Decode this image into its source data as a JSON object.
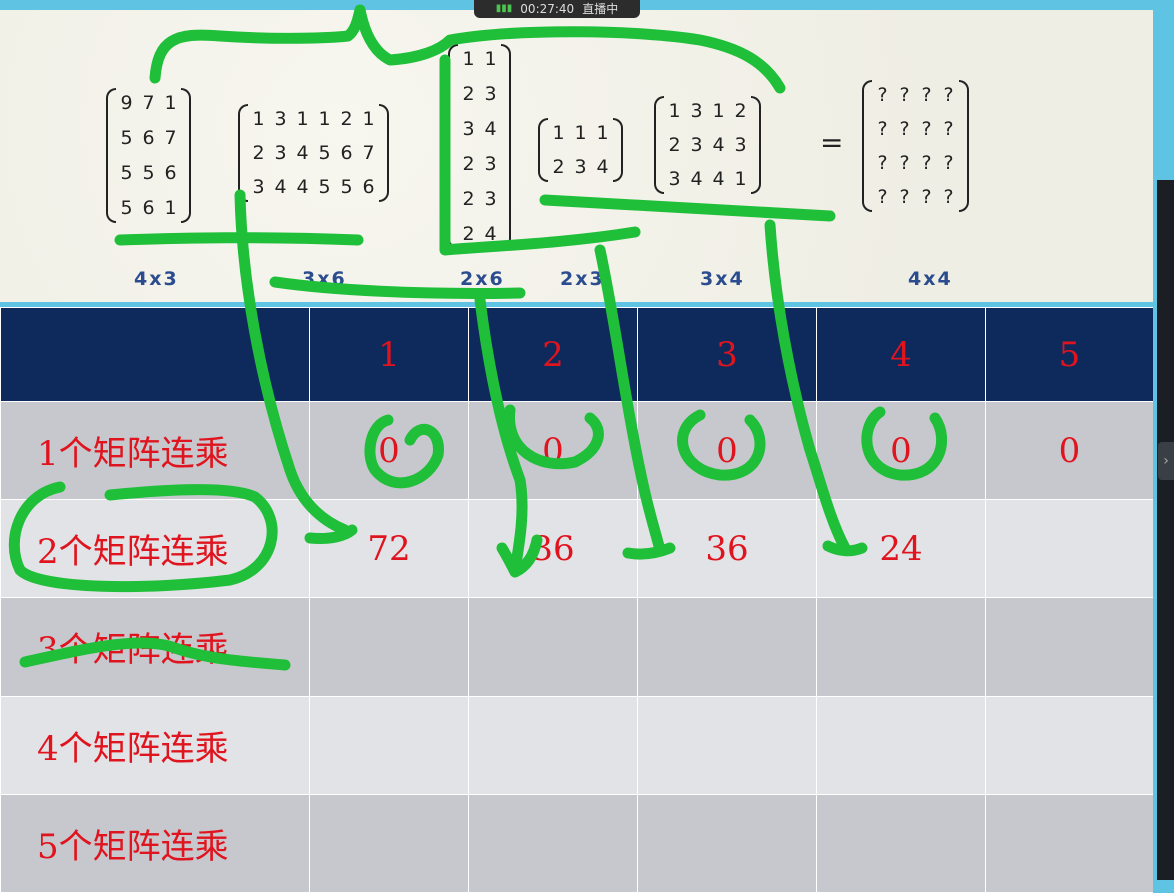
{
  "live_indicator": {
    "time": "00:27:40",
    "status": "直播中"
  },
  "matrices": [
    {
      "cols": 3,
      "rows": [
        [
          "9",
          "7",
          "1"
        ],
        [
          "5",
          "6",
          "7"
        ],
        [
          "5",
          "5",
          "6"
        ],
        [
          "5",
          "6",
          "1"
        ]
      ],
      "dim": "4x3"
    },
    {
      "cols": 6,
      "rows": [
        [
          "1",
          "3",
          "1",
          "1",
          "2",
          "1"
        ],
        [
          "2",
          "3",
          "4",
          "5",
          "6",
          "7"
        ],
        [
          "3",
          "4",
          "4",
          "5",
          "5",
          "6"
        ]
      ],
      "dim": "3x6"
    },
    {
      "cols": 2,
      "rows": [
        [
          "1",
          "1"
        ],
        [
          "2",
          "3"
        ],
        [
          "3",
          "4"
        ],
        [
          "2",
          "3"
        ],
        [
          "2",
          "3"
        ],
        [
          "2",
          "4"
        ]
      ],
      "dim": "2x6"
    },
    {
      "cols": 3,
      "rows": [
        [
          "1",
          "1",
          "1"
        ],
        [
          "2",
          "3",
          "4"
        ]
      ],
      "dim": "2x3"
    },
    {
      "cols": 4,
      "rows": [
        [
          "1",
          "3",
          "1",
          "2"
        ],
        [
          "2",
          "3",
          "4",
          "3"
        ],
        [
          "3",
          "4",
          "4",
          "1"
        ]
      ],
      "dim": "3x4"
    },
    {
      "cols": 4,
      "rows": [
        [
          "?",
          "?",
          "?",
          "?"
        ],
        [
          "?",
          "?",
          "?",
          "?"
        ],
        [
          "?",
          "?",
          "?",
          "?"
        ],
        [
          "?",
          "?",
          "?",
          "?"
        ]
      ],
      "dim": "4x4"
    }
  ],
  "equals_sign": "=",
  "table": {
    "header": [
      "",
      "1",
      "2",
      "3",
      "4",
      "5"
    ],
    "rows": [
      {
        "label": "1个矩阵连乘",
        "cells": [
          "0",
          "0",
          "0",
          "0",
          "0"
        ]
      },
      {
        "label": "2个矩阵连乘",
        "cells": [
          "72",
          "36",
          "36",
          "24",
          ""
        ]
      },
      {
        "label": "3个矩阵连乘",
        "cells": [
          "",
          "",
          "",
          "",
          ""
        ]
      },
      {
        "label": "4个矩阵连乘",
        "cells": [
          "",
          "",
          "",
          "",
          ""
        ]
      },
      {
        "label": "5个矩阵连乘",
        "cells": [
          "",
          "",
          "",
          "",
          ""
        ]
      }
    ]
  },
  "colors": {
    "header_bg": "#0e2a5c",
    "text_red": "#e0141e",
    "ink_green": "#1fbf3a",
    "dim_blue": "#2b4c8f"
  }
}
